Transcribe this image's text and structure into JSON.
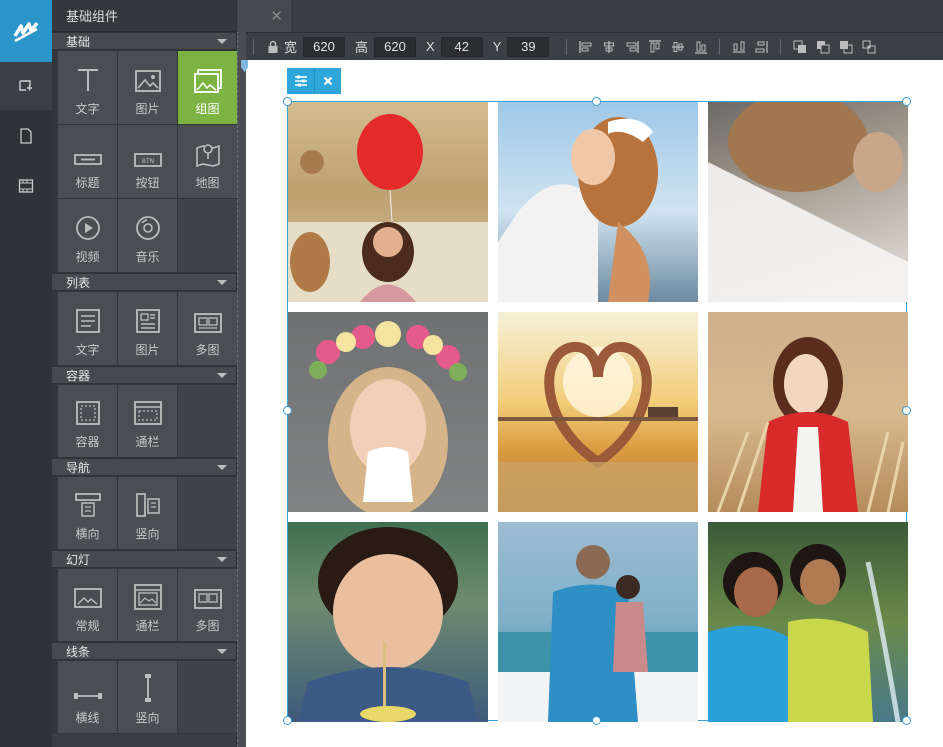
{
  "app": {
    "panel_title": "基础组件",
    "categories": [
      {
        "label": "基础",
        "items": [
          {
            "icon": "text-icon",
            "label": "文字"
          },
          {
            "icon": "image-icon",
            "label": "图片"
          },
          {
            "icon": "gallery-icon",
            "label": "组图",
            "selected": true
          },
          {
            "icon": "heading-icon",
            "label": "标题"
          },
          {
            "icon": "button-icon",
            "label": "按钮"
          },
          {
            "icon": "map-icon",
            "label": "地图"
          },
          {
            "icon": "video-icon",
            "label": "视频"
          },
          {
            "icon": "music-icon",
            "label": "音乐"
          }
        ]
      },
      {
        "label": "列表",
        "items": [
          {
            "icon": "text-list-icon",
            "label": "文字"
          },
          {
            "icon": "image-list-icon",
            "label": "图片"
          },
          {
            "icon": "multi-image-list-icon",
            "label": "多图"
          }
        ]
      },
      {
        "label": "容器",
        "items": [
          {
            "icon": "container-icon",
            "label": "容器"
          },
          {
            "icon": "full-width-container-icon",
            "label": "通栏"
          }
        ]
      },
      {
        "label": "导航",
        "items": [
          {
            "icon": "horizontal-nav-icon",
            "label": "横向"
          },
          {
            "icon": "vertical-nav-icon",
            "label": "竖向"
          }
        ]
      },
      {
        "label": "幻灯",
        "items": [
          {
            "icon": "slideshow-icon",
            "label": "常规"
          },
          {
            "icon": "full-width-slideshow-icon",
            "label": "通栏"
          },
          {
            "icon": "multi-image-slideshow-icon",
            "label": "多图"
          }
        ]
      },
      {
        "label": "线条",
        "items": [
          {
            "icon": "horizontal-line-icon",
            "label": "横线"
          },
          {
            "icon": "vertical-line-icon",
            "label": "竖向"
          }
        ]
      }
    ]
  },
  "toolbar": {
    "width_label": "宽",
    "width_value": "620",
    "height_label": "高",
    "height_value": "620",
    "x_label": "X",
    "x_value": "42",
    "y_label": "Y",
    "y_value": "39"
  },
  "tab": {
    "close_glyph": "✕"
  },
  "colors": {
    "accent": "#2ea6d9",
    "selected": "#7cb342",
    "sidebar": "#3a3d42"
  }
}
